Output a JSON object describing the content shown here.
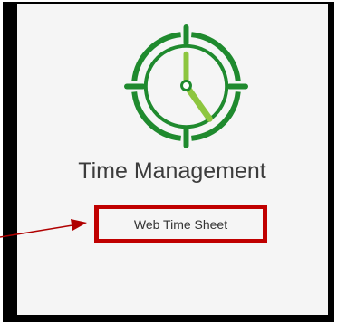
{
  "card": {
    "title": "Time Management",
    "link_label": "Web Time Sheet",
    "icon": "clock-icon"
  },
  "colors": {
    "clock_green_dark": "#1f8a2e",
    "clock_green_light": "#8dc63f",
    "highlight_red": "#c00000",
    "arrow_red": "#b00000"
  }
}
